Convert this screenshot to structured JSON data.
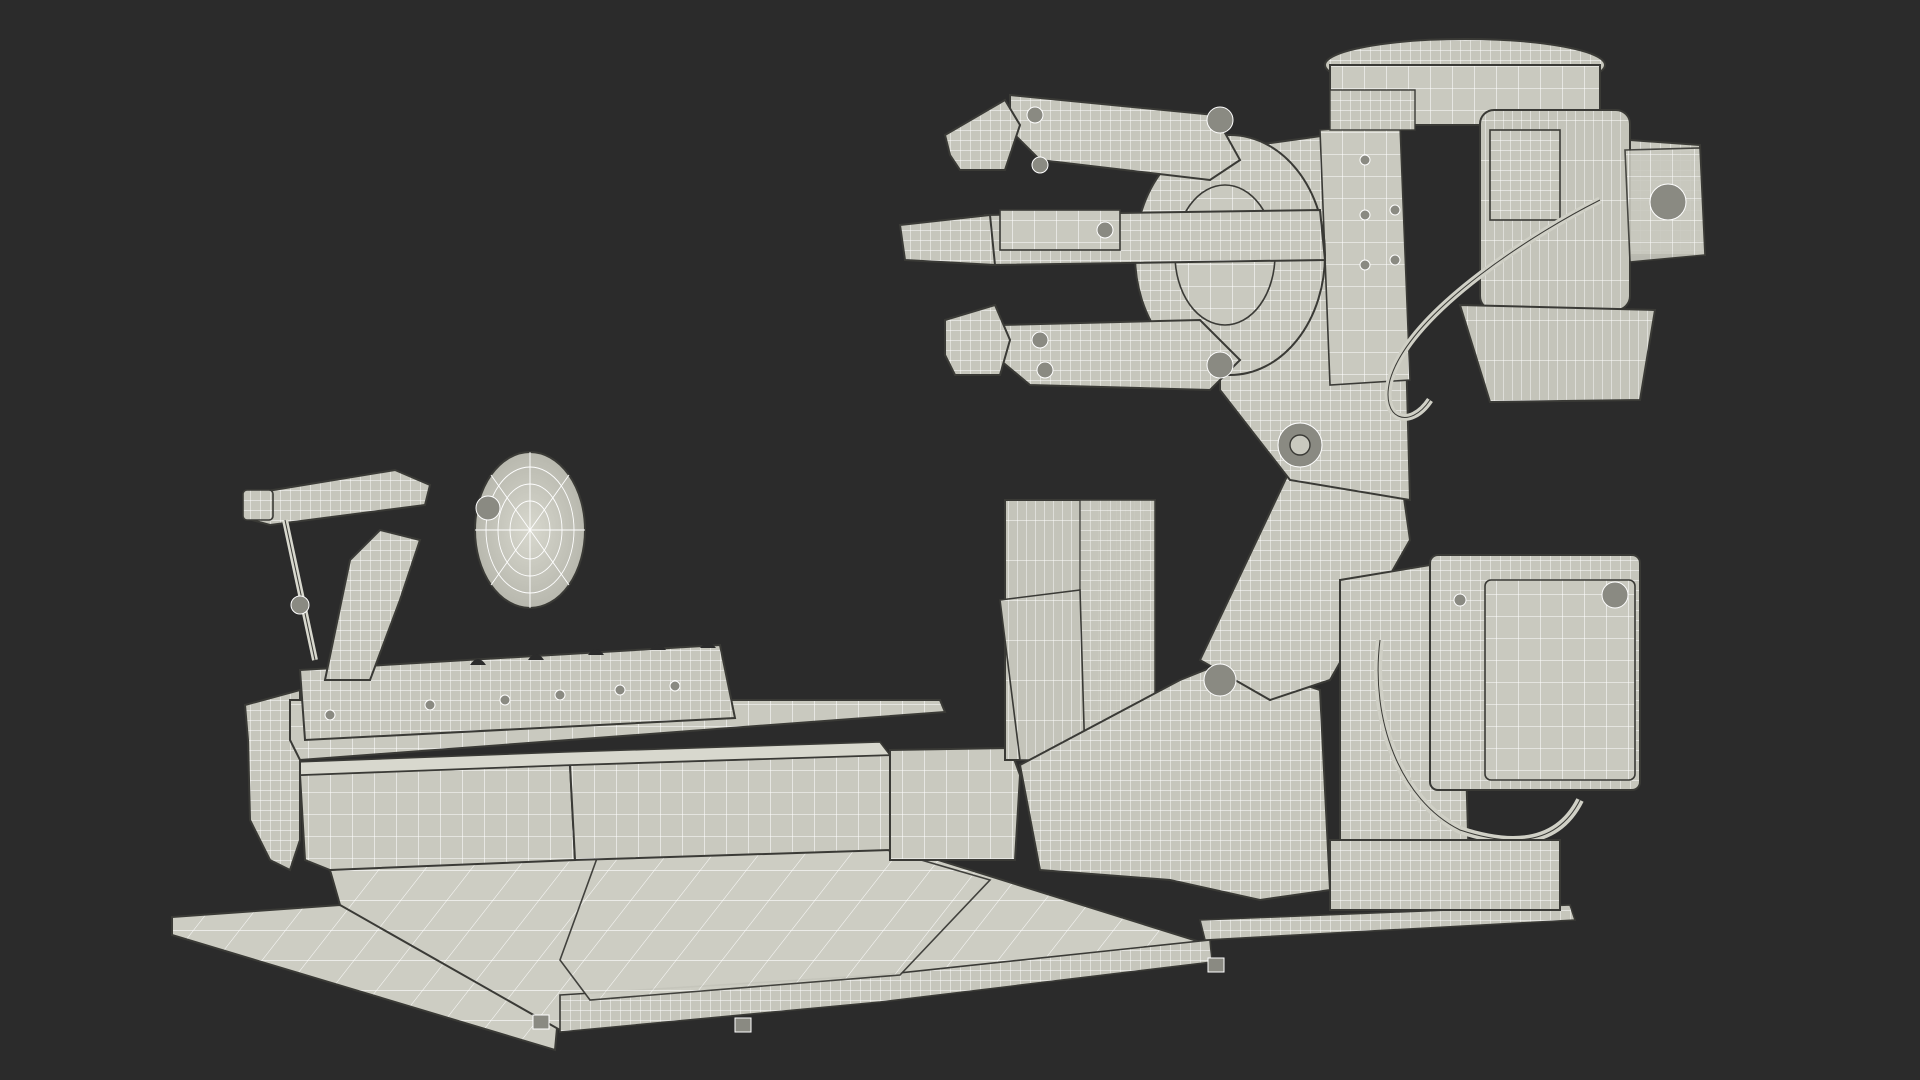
{
  "scene": {
    "subject": "tire-changer-machine-wireframe",
    "background_color": "#2b2b2b",
    "mesh_fill": "#c9c9bf",
    "mesh_wire": "#ffffff",
    "edge_color": "#3a3a36"
  }
}
